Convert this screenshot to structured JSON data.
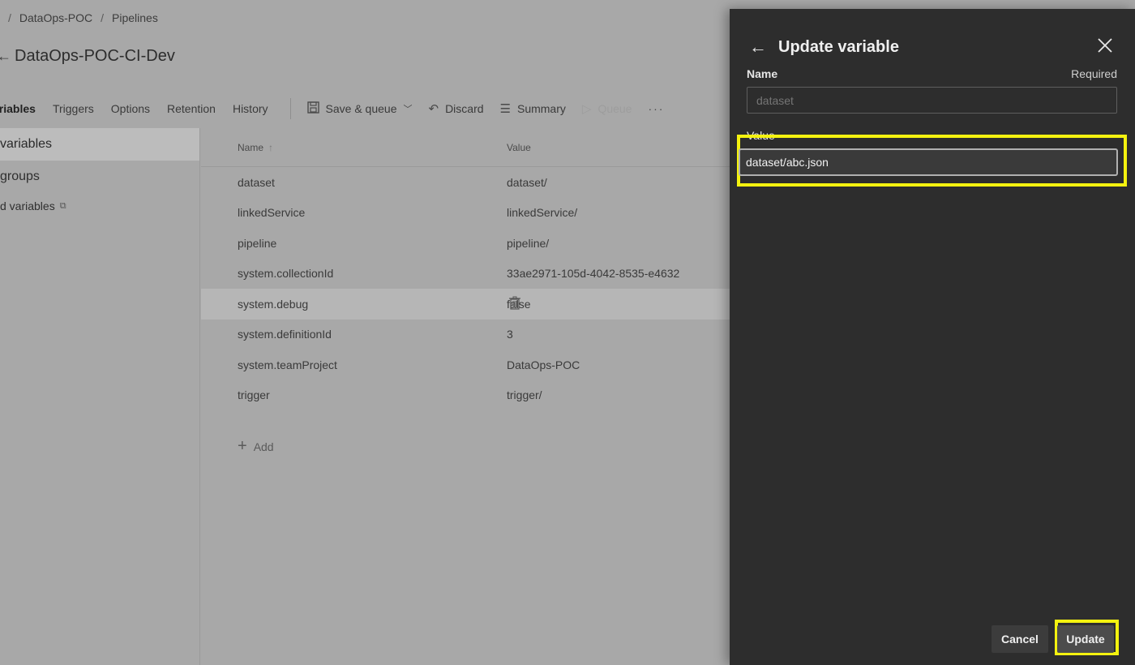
{
  "breadcrumb": {
    "items": [
      "DataOps-POC",
      "Pipelines"
    ],
    "separator": "/"
  },
  "page": {
    "title": "DataOps-POC-CI-Dev"
  },
  "toolbar": {
    "tabs": [
      "ariables",
      "Triggers",
      "Options",
      "Retention",
      "History"
    ],
    "save_queue": "Save & queue",
    "discard": "Discard",
    "summary": "Summary",
    "queue": "Queue",
    "more": "···"
  },
  "left_nav": {
    "items": [
      "variables",
      "groups",
      "d variables"
    ]
  },
  "table": {
    "headers": {
      "name": "Name",
      "value": "Value"
    },
    "rows": [
      {
        "name": "dataset",
        "value": "dataset/"
      },
      {
        "name": "linkedService",
        "value": "linkedService/"
      },
      {
        "name": "pipeline",
        "value": "pipeline/"
      },
      {
        "name": "system.collectionId",
        "value": "33ae2971-105d-4042-8535-e4632"
      },
      {
        "name": "system.debug",
        "value": "false"
      },
      {
        "name": "system.definitionId",
        "value": "3"
      },
      {
        "name": "system.teamProject",
        "value": "DataOps-POC"
      },
      {
        "name": "trigger",
        "value": "trigger/"
      }
    ],
    "add_label": "Add"
  },
  "dialog": {
    "title": "Update variable",
    "name_label": "Name",
    "required_label": "Required",
    "name_placeholder": "dataset",
    "value_label": "Value",
    "value": "dataset/abc.json",
    "cancel_label": "Cancel",
    "update_label": "Update"
  },
  "colors": {
    "highlight": "#f4f20f",
    "panel_bg": "#2d2d2d",
    "overlay_bg": "#a8a8a8"
  }
}
